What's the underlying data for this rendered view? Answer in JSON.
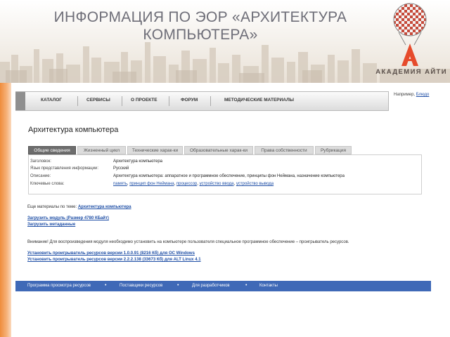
{
  "slide": {
    "title_line1": "ИНФОРМАЦИЯ ПО ЭОР «АРХИТЕКТУРА",
    "title_line2": "КОМПЬЮТЕРА»",
    "brand": "АКАДЕМИЯ АЙТИ",
    "accent_color": "#ef8d3c"
  },
  "menu": {
    "items": [
      "КАТАЛОГ",
      "СЕРВИСЫ",
      "О ПРОЕКТЕ",
      "ФОРУМ",
      "МЕТОДИЧЕСКИЕ МАТЕРИАЛЫ"
    ]
  },
  "example": {
    "prefix": "Например,",
    "link": "Блюдо"
  },
  "page": {
    "title": "Архитектура компьютера"
  },
  "tabs": [
    {
      "label": "Общие сведения",
      "active": true
    },
    {
      "label": "Жизненный цикл",
      "active": false
    },
    {
      "label": "Технические харак-ки",
      "active": false
    },
    {
      "label": "Образовательные харак-ки",
      "active": false
    },
    {
      "label": "Права собственности",
      "active": false
    },
    {
      "label": "Рубрикация",
      "active": false
    }
  ],
  "info": {
    "title_label": "Заголовок:",
    "title_value": "Архитектура компьютера",
    "lang_label": "Язык представления информации:",
    "lang_value": "Русский",
    "desc_label": "Описание:",
    "desc_value": "Архитектура компьютера: аппаратное и программное обеспечение, принципы фон Неймана, назначение компьютера",
    "kw_label": "Ключевые слова:",
    "keywords": [
      "память",
      "принцип фон Неймана",
      "процессор",
      "устройство ввода",
      "устройство вывода"
    ]
  },
  "more": {
    "prefix": "Еще материалы по теме:",
    "link": "Архитектура компьютера"
  },
  "downloads": {
    "module": "Загрузить модуль (Размер 4780 КБайт)",
    "metadata": "Загрузить метаданные"
  },
  "notice": "Внимание! Для воспроизведения модуля необходимо установить на компьютере пользователя специальное программное обеспечение – проигрыватель ресурсов.",
  "installers": {
    "windows": "Установить проигрыватель ресурсов версии 1.0.0.91 (8216 Кб) для ОС Windows",
    "linux": "Установить проигрыватель ресурсов версии 2.2.2.138 (33673 Кб) для ALT Linux 4.1"
  },
  "footer": {
    "items": [
      "Программа просмотра ресурсов",
      "Поставщики ресурсов",
      "Для разработчиков",
      "Контакты"
    ],
    "bullet": "•",
    "color": "#3f69b7"
  }
}
